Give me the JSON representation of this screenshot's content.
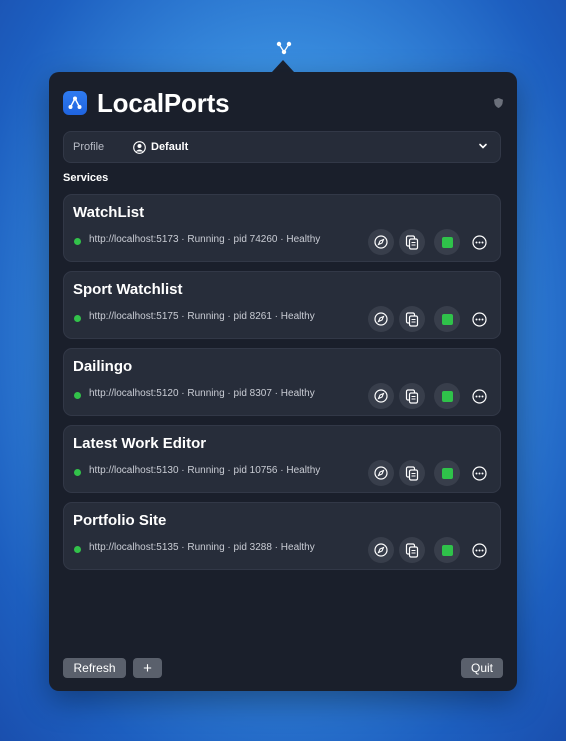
{
  "app": {
    "title": "LocalPorts"
  },
  "profile": {
    "label": "Profile",
    "value": "Default"
  },
  "section": {
    "services_label": "Services"
  },
  "services": [
    {
      "name": "WatchList",
      "status": "http://localhost:5173 · Running · pid 74260 · Healthy"
    },
    {
      "name": "Sport Watchlist",
      "status": "http://localhost:5175 · Running · pid 8261 · Healthy"
    },
    {
      "name": "Dailingo",
      "status": "http://localhost:5120 · Running · pid 8307 · Healthy"
    },
    {
      "name": "Latest Work Editor",
      "status": "http://localhost:5130 · Running · pid 10756 · Healthy"
    },
    {
      "name": "Portfolio Site",
      "status": "http://localhost:5135 · Running · pid 3288 · Healthy"
    }
  ],
  "footer": {
    "refresh_label": "Refresh",
    "add_label": "+",
    "quit_label": "Quit"
  },
  "colors": {
    "accent": "#2f7bf0",
    "healthy": "#32c24a",
    "panel": "#1a1f2b"
  }
}
